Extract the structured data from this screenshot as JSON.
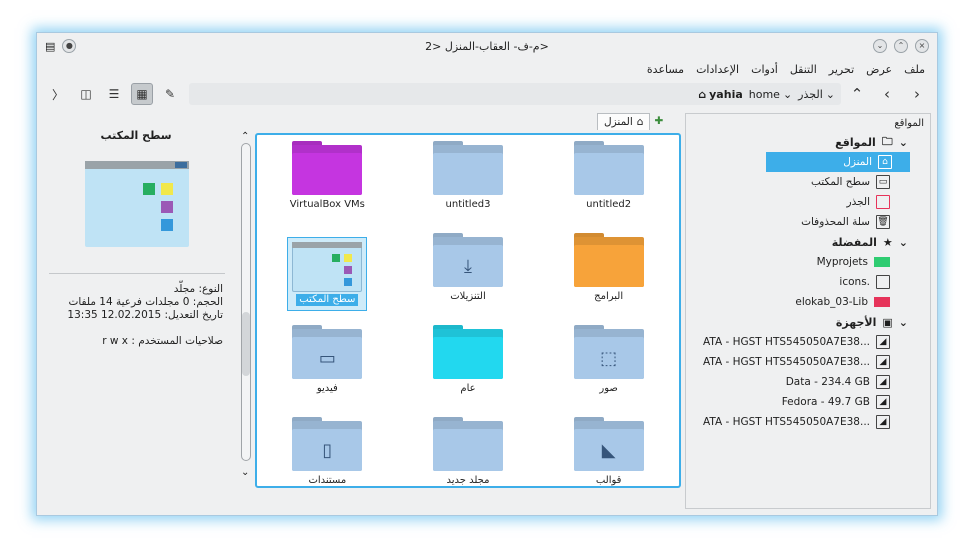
{
  "window": {
    "title": "م-ف- العقاب-المنزل <2>"
  },
  "menu": [
    "ملف",
    "عرض",
    "تحرير",
    "التنقل",
    "أدوات",
    "الإعدادات",
    "مساعدة"
  ],
  "breadcrumb": {
    "root": "الجذر",
    "home": "home",
    "user": "yahia"
  },
  "places_panel": {
    "title": "المواقع",
    "sections": {
      "places": "المواقع",
      "bookmarks": "المفضلة",
      "devices": "الأجهزة"
    },
    "places_items": [
      "المنزل",
      "سطح المكتب",
      "الجذر",
      "سلة المحذوفات"
    ],
    "bookmark_items": [
      {
        "label": "Myprojets",
        "color": "#2ecc71"
      },
      {
        "label": "icons.",
        "color": ""
      },
      {
        "label": "elokab_03-Lib",
        "color": "#e6335a"
      }
    ],
    "device_items": [
      "ATA - HGST HTS545050A7E38...",
      "ATA - HGST HTS545050A7E38...",
      "Data - 234.4 GB",
      "Fedora - 49.7 GB",
      "ATA - HGST HTS545050A7E38..."
    ]
  },
  "tab": {
    "label": "المنزل"
  },
  "files": [
    {
      "label": "untitled2",
      "color": "#a8c8e8"
    },
    {
      "label": "untitled3",
      "color": "#a8c8e8"
    },
    {
      "label": "VirtualBox VMs",
      "color": "#c535e0"
    },
    {
      "label": "البرامج",
      "color": "#f7a33a"
    },
    {
      "label": "التنزيلات",
      "color": "#a8c8e8"
    },
    {
      "label": "سطح المكتب",
      "color": "#a8c8e8"
    },
    {
      "label": "صور",
      "color": "#a8c8e8"
    },
    {
      "label": "عام",
      "color": "#22d8ef"
    },
    {
      "label": "فيديو",
      "color": "#a8c8e8"
    },
    {
      "label": "قوالب",
      "color": "#a8c8e8"
    },
    {
      "label": "مجلد جديد",
      "color": "#a8c8e8"
    },
    {
      "label": "مستندات",
      "color": "#a8c8e8"
    }
  ],
  "info": {
    "name": "سطح المكتب",
    "type": "النوع: مجلّد",
    "size": "الحجم: 0 مجلدات فرعية 14 ملفات",
    "modified": "تاريخ التعديل: 12.02.2015 13:35",
    "perms": "صلاحيات المستخدم : r w x"
  },
  "colors": {
    "accent": "#3daee9"
  }
}
